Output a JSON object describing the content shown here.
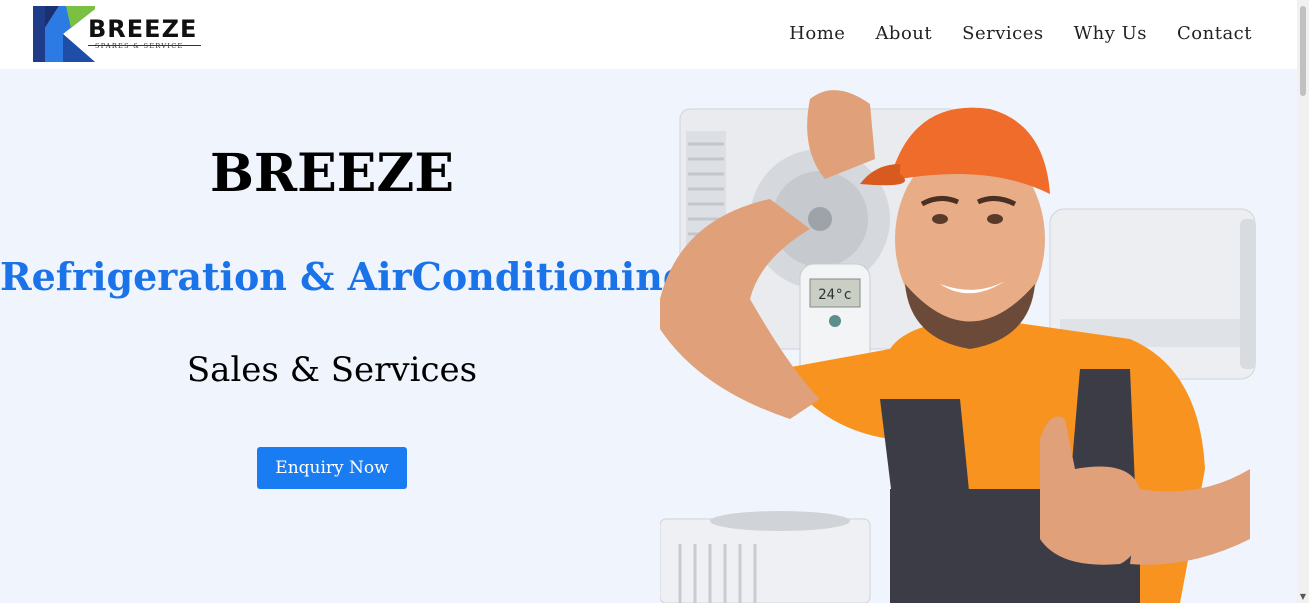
{
  "brand": {
    "name": "BREEZE",
    "tagline": "SPARES & SERVICE",
    "colors": {
      "navy": "#1f3c8a",
      "blue": "#2c7be5",
      "green": "#7ac143"
    }
  },
  "nav": {
    "items": [
      {
        "label": "Home"
      },
      {
        "label": "About"
      },
      {
        "label": "Services"
      },
      {
        "label": "Why Us"
      },
      {
        "label": "Contact"
      }
    ]
  },
  "hero": {
    "title": "BREEZE",
    "subtitle": "Refrigeration & AirConditioning",
    "tagline": "Sales & Services",
    "cta_label": "Enquiry Now",
    "remote_display": "24°c",
    "colors": {
      "background": "#f0f4fd",
      "subtitle": "#1a73e8",
      "button": "#1a7cf2"
    }
  }
}
